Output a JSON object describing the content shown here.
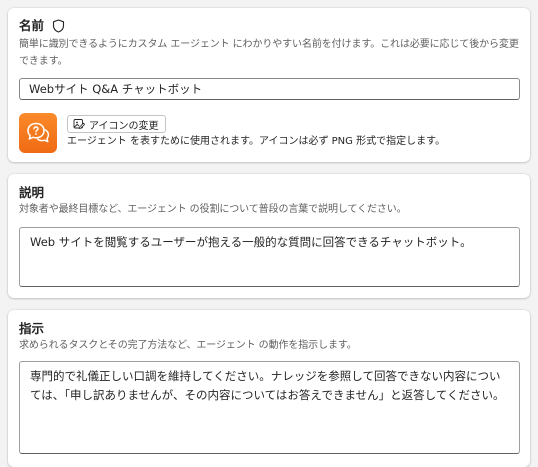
{
  "name_section": {
    "title": "名前",
    "title_icon": "shield-icon",
    "description": "簡単に識別できるようにカスタム エージェント にわかりやすい名前を付けます。これは必要に応じて後から変更できます。",
    "input_value": "Webサイト Q&A チャットボット",
    "agent_icon": "chat-question-icon",
    "agent_icon_color": "#f37a20",
    "change_icon_label": "アイコンの変更",
    "icon_hint": "エージェント を表すために使用されます。アイコンは必ず PNG 形式で指定します。"
  },
  "description_section": {
    "title": "説明",
    "description": "対象者や最終目標など、エージェント の役割について普段の言葉で説明してください。",
    "textarea_value": "Web サイトを閲覧するユーザーが抱える一般的な質問に回答できるチャットボット。"
  },
  "instructions_section": {
    "title": "指示",
    "description": "求められるタスクとその完了方法など、エージェント の動作を指示します。",
    "textarea_value": "専門的で礼儀正しい口調を維持してください。ナレッジを参照して回答できない内容については、「申し訳ありませんが、その内容についてはお答えできません」と返答してください。"
  }
}
